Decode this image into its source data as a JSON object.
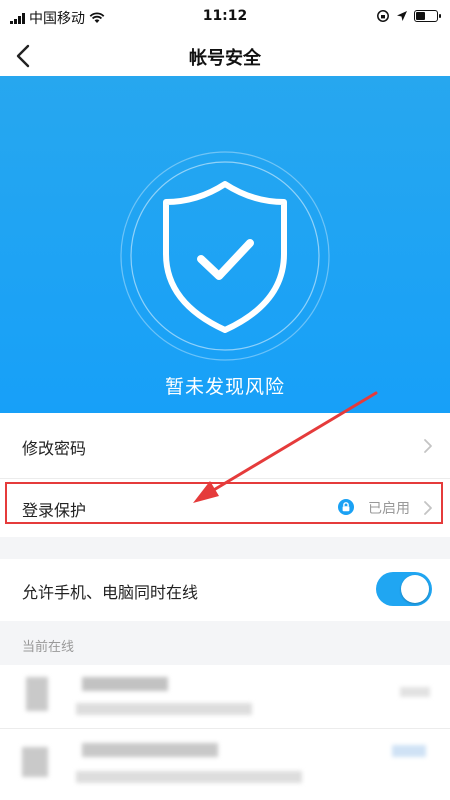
{
  "status_bar": {
    "carrier": "中国移动",
    "time": "11:12"
  },
  "nav": {
    "title": "帐号安全"
  },
  "hero": {
    "status_text": "暂未发现风险",
    "icon": "shield-check-icon",
    "accent_color": "#1ea0f6"
  },
  "menu": {
    "change_password": "修改密码",
    "login_protection": "登录保护",
    "login_protection_status": "已启用",
    "allow_simultaneous_online": "允许手机、电脑同时在线",
    "allow_simultaneous_online_enabled": true
  },
  "online_section": {
    "header": "当前在线"
  },
  "annotation": {
    "highlight_color": "#e53b3b"
  }
}
